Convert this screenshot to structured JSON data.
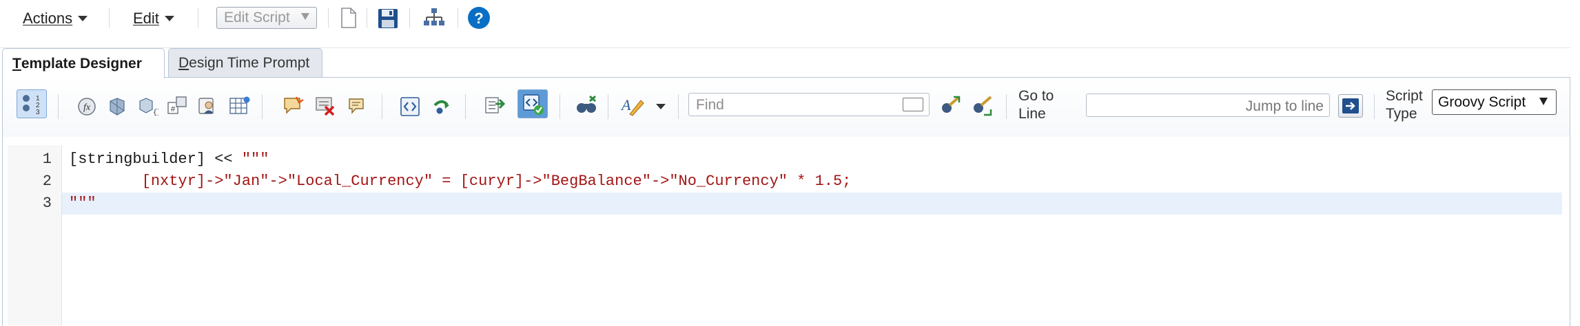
{
  "menubar": {
    "actions_label": "Actions",
    "edit_label": "Edit",
    "edit_script_label": "Edit Script"
  },
  "icons": {
    "new_doc": "new-document-icon",
    "save": "save-icon",
    "structure": "hierarchy-icon",
    "help": "help-icon"
  },
  "tabs": [
    {
      "label_first": "T",
      "label_rest": "emplate Designer",
      "active": true
    },
    {
      "label_first": "D",
      "label_rest": "esign Time Prompt",
      "active": false
    }
  ],
  "editor_toolbar": {
    "find_placeholder": "Find",
    "goto_label_line1": "Go to",
    "goto_label_line2": "Line",
    "jump_placeholder": "Jump to line",
    "script_type_line1": "Script",
    "script_type_line2": "Type",
    "script_type_value": "Groovy Script"
  },
  "code": {
    "line_numbers": [
      "1",
      "2",
      "3"
    ],
    "line1_black": "[stringbuilder] << ",
    "line1_red": "\"\"\"",
    "line2": "        [nxtyr]->\"Jan\"->\"Local_Currency\" = [curyr]->\"BegBalance\"->\"No_Currency\" * 1.5;",
    "line3": "\"\"\"",
    "highlighted_line": 3
  },
  "colors": {
    "accent_blue": "#0a6fc4",
    "code_red": "#a31515",
    "highlight_line": "#e7f0fb"
  }
}
